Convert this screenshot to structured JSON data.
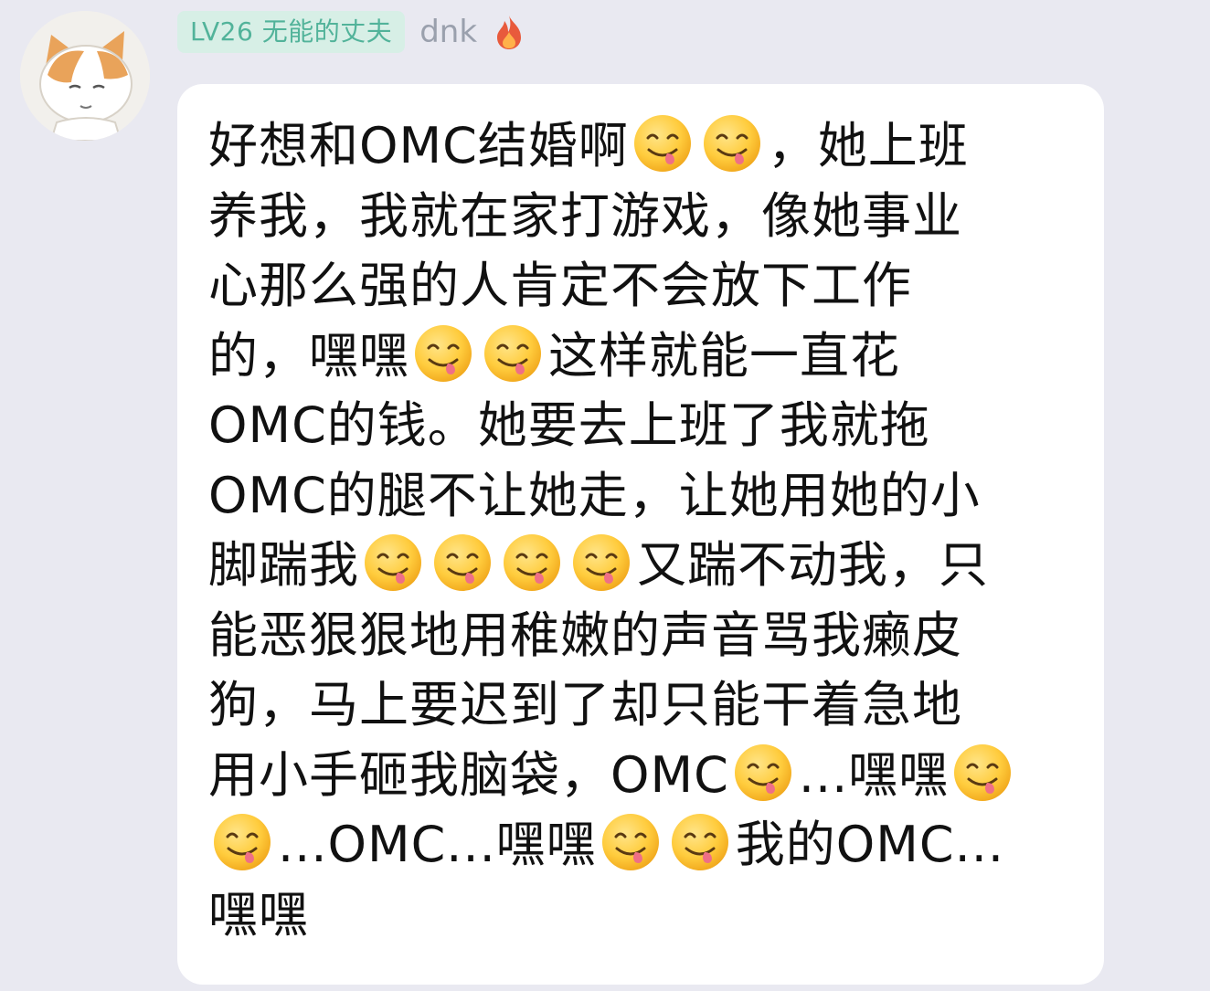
{
  "header": {
    "level_badge": "LV26 无能的丈夫",
    "username": "dnk",
    "user_icon": "fire-icon"
  },
  "avatar": {
    "icon": "cat-avatar"
  },
  "message": {
    "emoji_icon": "yum-face-emoji",
    "lines": [
      [
        {
          "t": "好想和OMC结婚啊"
        },
        {
          "e": 1
        },
        {
          "e": 1
        },
        {
          "t": "，她上班"
        }
      ],
      [
        {
          "t": "养我，我就在家打游戏，像她事业"
        }
      ],
      [
        {
          "t": "心那么强的人肯定不会放下工作"
        }
      ],
      [
        {
          "t": "的，嘿嘿"
        },
        {
          "e": 1
        },
        {
          "e": 1
        },
        {
          "t": "这样就能一直花"
        }
      ],
      [
        {
          "t": "OMC的钱。她要去上班了我就拖"
        }
      ],
      [
        {
          "t": "OMC的腿不让她走，让她用她的小"
        }
      ],
      [
        {
          "t": "脚踹我"
        },
        {
          "e": 1
        },
        {
          "e": 1
        },
        {
          "e": 1
        },
        {
          "e": 1
        },
        {
          "t": "又踹不动我，只"
        }
      ],
      [
        {
          "t": "能恶狠狠地用稚嫩的声音骂我癞皮"
        }
      ],
      [
        {
          "t": "狗，马上要迟到了却只能干着急地"
        }
      ],
      [
        {
          "t": "用小手砸我脑袋，OMC"
        },
        {
          "e": 1
        },
        {
          "t": "...嘿嘿"
        },
        {
          "e": 1
        }
      ],
      [
        {
          "e": 1
        },
        {
          "t": "...OMC...嘿嘿"
        },
        {
          "e": 1
        },
        {
          "e": 1
        },
        {
          "t": "我的OMC..."
        }
      ],
      [
        {
          "t": "嘿嘿"
        }
      ]
    ]
  }
}
